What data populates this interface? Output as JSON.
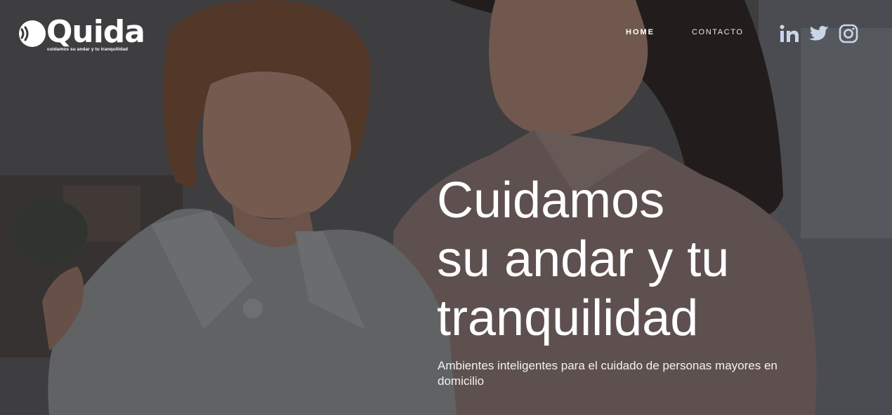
{
  "brand": {
    "name": "Quida",
    "tagline": "cuidamos su andar y tu tranquilidad"
  },
  "nav": {
    "items": [
      {
        "label": "HOME",
        "active": true
      },
      {
        "label": "CONTACTO",
        "active": false
      }
    ]
  },
  "social": [
    {
      "icon": "linkedin-icon"
    },
    {
      "icon": "twitter-icon"
    },
    {
      "icon": "instagram-icon"
    }
  ],
  "hero": {
    "headline_lines": [
      "Cuidamos",
      "su andar y tu",
      "tranquilidad"
    ],
    "subtitle": "Ambientes inteligentes para el cuidado de personas mayores en domicilio"
  },
  "colors": {
    "text": "#ffffff",
    "icon": "#c9d6e8"
  }
}
